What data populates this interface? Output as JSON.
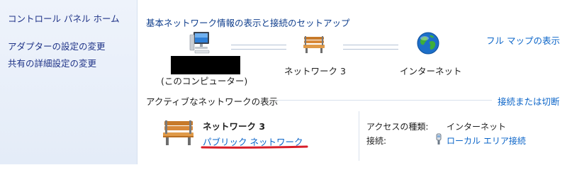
{
  "sidebar": {
    "home": "コントロール パネル ホーム",
    "links": [
      "アダプターの設定の変更",
      "共有の詳細設定の変更"
    ]
  },
  "header": {
    "title": "基本ネットワーク情報の表示と接続のセットアップ",
    "full_map": "フル マップの表示"
  },
  "map": {
    "this_computer": "(このコンピューター)",
    "network": "ネットワーク 3",
    "internet": "インターネット"
  },
  "active": {
    "title": "アクティブなネットワークの表示",
    "connect_link": "接続または切断",
    "network_name": "ネットワーク 3",
    "network_type": "パブリック ネットワーク",
    "access_type_label": "アクセスの種類:",
    "access_type_value": "インターネット",
    "connections_label": "接続:",
    "connections_value": "ローカル エリア接続"
  },
  "colors": {
    "link": "#0a64c8",
    "sidebar_bg": "#e9f0fa",
    "annotation_underline": "#d81e2a"
  },
  "icons": {
    "computer": "computer-icon",
    "network": "bench-icon",
    "internet": "globe-icon",
    "connection": "plug-icon"
  }
}
